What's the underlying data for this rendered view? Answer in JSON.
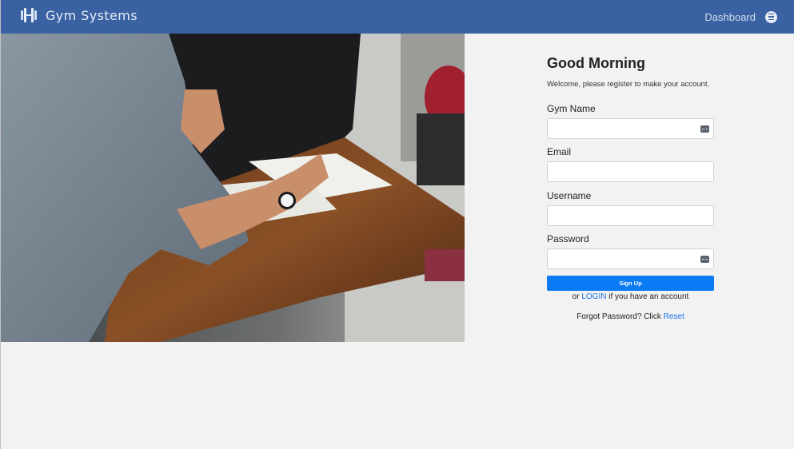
{
  "navbar": {
    "brand": "Gym Systems",
    "dashboard_label": "Dashboard",
    "menu_icon": "hamburger-circle-icon",
    "logo_icon": "dumbbell-icon"
  },
  "hero": {
    "alt": "hero-photo"
  },
  "form": {
    "title": "Good Morning",
    "subtitle": "Welcome, please register to make your account.",
    "gym_name_label": "Gym Name",
    "email_label": "Email",
    "username_label": "Username",
    "password_label": "Password",
    "gym_name_value": "",
    "email_value": "",
    "username_value": "",
    "password_value": "",
    "signup_label": "Sign Up",
    "login_prefix": "or ",
    "login_link": "LOGIN",
    "login_suffix": " if you have an account",
    "forgot_prefix": "Forgot Password? Click ",
    "forgot_link": "Reset"
  },
  "colors": {
    "navbar": "#3a62a3",
    "primary_button": "#0b7af5",
    "link": "#1a73e8",
    "background": "#f2f2f2"
  }
}
